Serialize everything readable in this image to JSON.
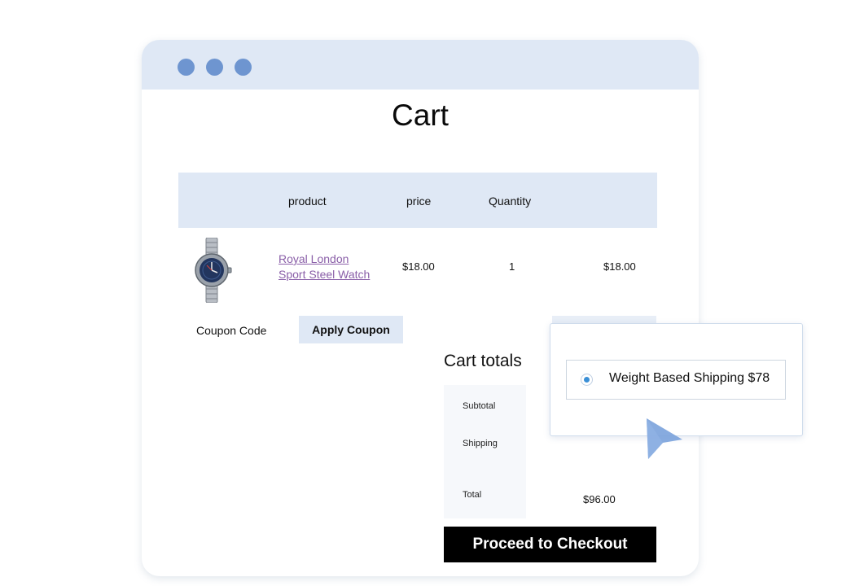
{
  "window": {
    "controls": [
      "close",
      "minimize",
      "maximize"
    ]
  },
  "page": {
    "title": "Cart"
  },
  "table": {
    "headers": [
      "product",
      "price",
      "Quantity"
    ],
    "row": {
      "image_icon": "wristwatch-image",
      "product_line1": "Royal London",
      "product_line2": "Sport Steel Watch",
      "price": "$18.00",
      "quantity": "1",
      "subtotal": "$18.00"
    }
  },
  "coupon": {
    "label": "Coupon Code",
    "button": "Apply Coupon"
  },
  "totals": {
    "title": "Cart totals",
    "labels": [
      "Subtotal",
      "Shipping",
      "Total"
    ],
    "total_value": "$96.00"
  },
  "checkout": {
    "button": "Proceed to Checkout"
  },
  "shipping_popup": {
    "option_label": "Weight Based Shipping $78",
    "selected": true
  },
  "colors": {
    "titlebar": "#dfe8f5",
    "dots": "#6e95d0",
    "link": "#8a5fa8",
    "radio": "#3a8fd6",
    "cursor": "#7aa2dc"
  },
  "icons": {
    "cursor": "pointer-arrow-icon"
  }
}
